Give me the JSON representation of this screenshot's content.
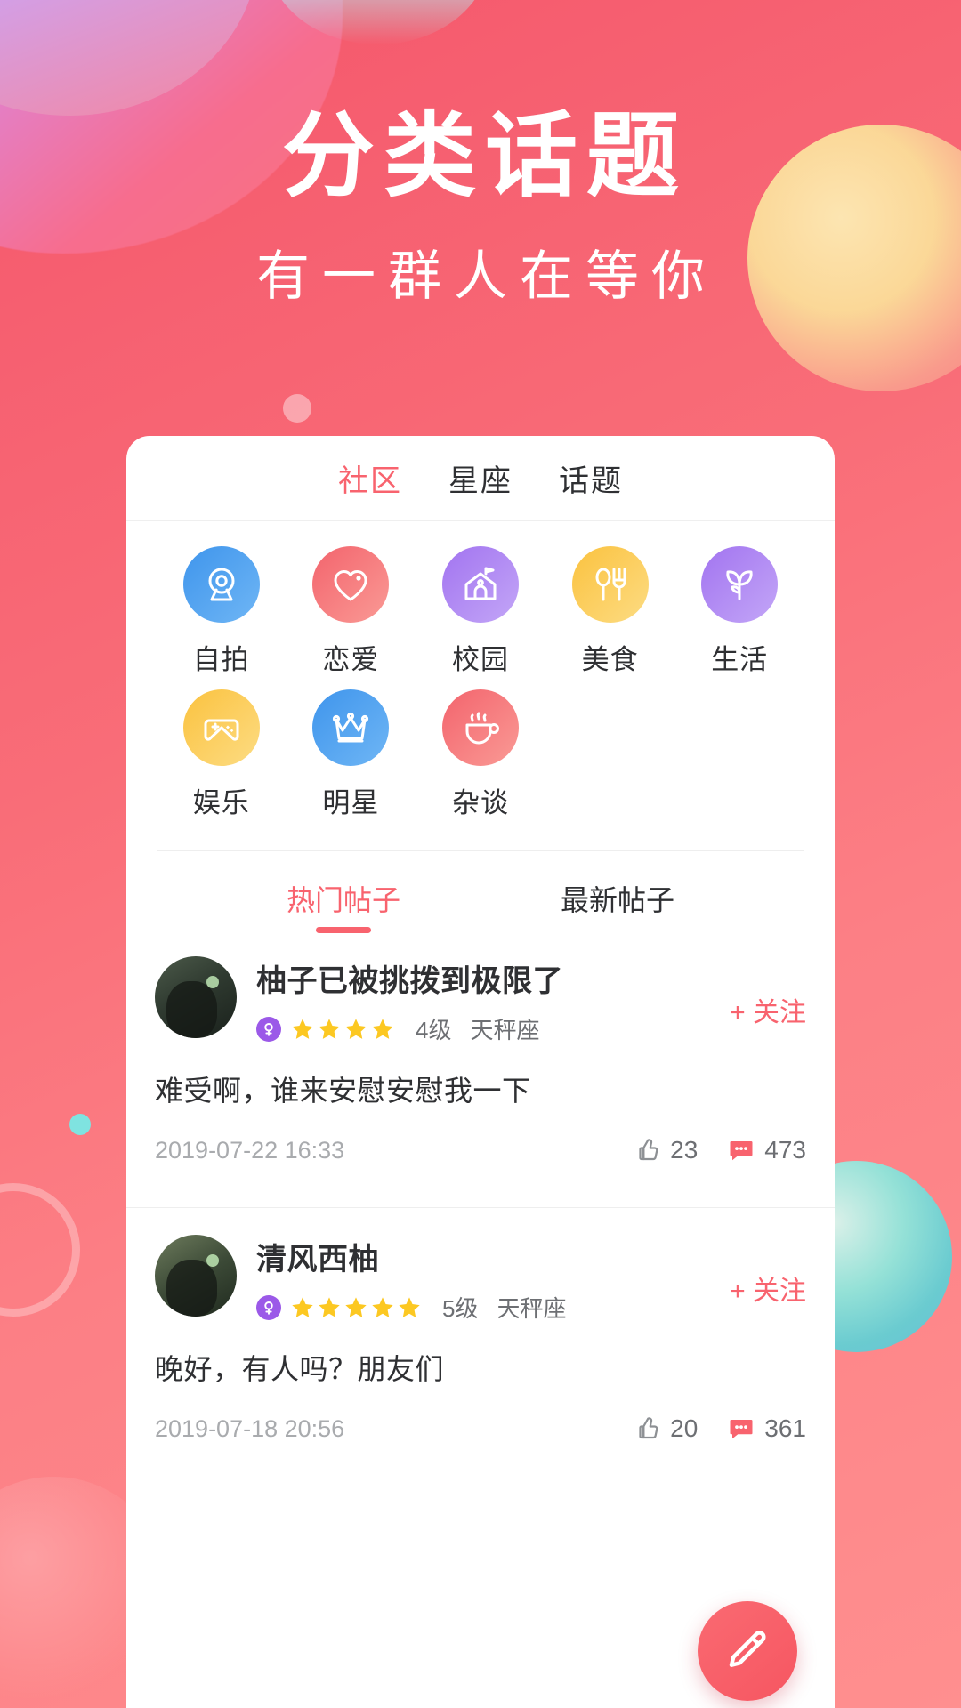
{
  "hero": {
    "title": "分类话题",
    "subtitle": "有一群人在等你"
  },
  "colors": {
    "accent": "#f8636e",
    "background_start": "#f4566b",
    "background_end": "#ff8f8f",
    "text_primary": "#2f3033",
    "text_muted": "#a9abae"
  },
  "top_tabs": [
    {
      "label": "社区",
      "active": true
    },
    {
      "label": "星座",
      "active": false
    },
    {
      "label": "话题",
      "active": false
    }
  ],
  "categories": [
    {
      "label": "自拍",
      "icon": "camera-icon",
      "color": "#3f95ec"
    },
    {
      "label": "恋爱",
      "icon": "heart-icon",
      "color": "#f3646d"
    },
    {
      "label": "校园",
      "icon": "school-icon",
      "color": "#a274f0"
    },
    {
      "label": "美食",
      "icon": "cutlery-icon",
      "color": "#fbc23f"
    },
    {
      "label": "生活",
      "icon": "flower-icon",
      "color": "#a274f0"
    },
    {
      "label": "娱乐",
      "icon": "gamepad-icon",
      "color": "#fbc23f"
    },
    {
      "label": "明星",
      "icon": "crown-icon",
      "color": "#3f95ec"
    },
    {
      "label": "杂谈",
      "icon": "coffee-icon",
      "color": "#f3646d"
    }
  ],
  "post_tabs": [
    {
      "label": "热门帖子",
      "active": true
    },
    {
      "label": "最新帖子",
      "active": false
    }
  ],
  "posts": [
    {
      "title": "柚子已被挑拨到极限了",
      "level": "4级",
      "zodiac": "天秤座",
      "stars": 4,
      "follow_label": "+ 关注",
      "body": "难受啊，谁来安慰安慰我一下",
      "date": "2019-07-22 16:33",
      "likes": "23",
      "comments": "473"
    },
    {
      "title": "清风西柚",
      "level": "5级",
      "zodiac": "天秤座",
      "stars": 5,
      "follow_label": "+ 关注",
      "body": "晚好，有人吗？朋友们",
      "date": "2019-07-18 20:56",
      "likes": "20",
      "comments": "361"
    }
  ],
  "fab": {
    "icon": "pencil-icon"
  }
}
